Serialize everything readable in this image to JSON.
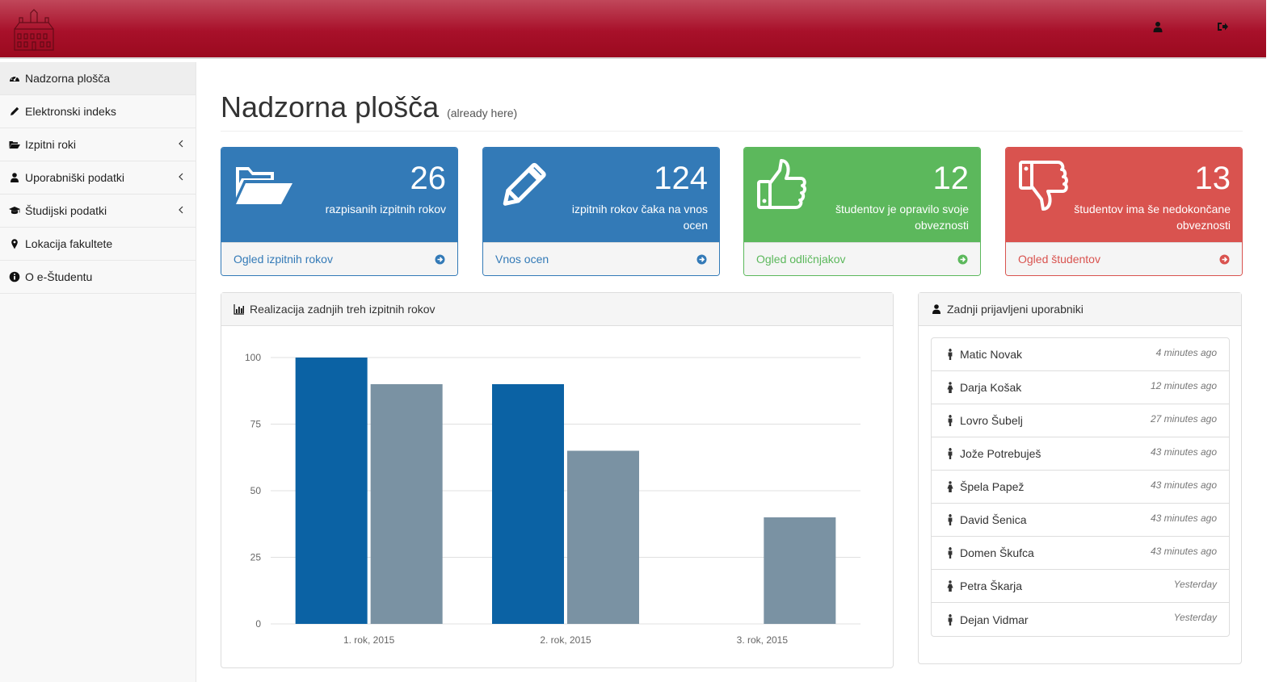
{
  "topbar": {
    "profile_icon": "user-icon",
    "logout_icon": "sign-out-icon"
  },
  "sidebar": {
    "items": [
      {
        "label": "Nadzorna plošča",
        "icon": "dashboard-icon",
        "active": true,
        "has_submenu": false
      },
      {
        "label": "Elektronski indeks",
        "icon": "pencil-icon",
        "active": false,
        "has_submenu": false
      },
      {
        "label": "Izpitni roki",
        "icon": "folder-open-icon",
        "active": false,
        "has_submenu": true
      },
      {
        "label": "Uporabniški podatki",
        "icon": "user-icon",
        "active": false,
        "has_submenu": true
      },
      {
        "label": "Študijski podatki",
        "icon": "graduation-cap-icon",
        "active": false,
        "has_submenu": true
      },
      {
        "label": "Lokacija fakultete",
        "icon": "map-marker-icon",
        "active": false,
        "has_submenu": false
      },
      {
        "label": "O e-Študentu",
        "icon": "info-circle-icon",
        "active": false,
        "has_submenu": false
      }
    ]
  },
  "header": {
    "title": "Nadzorna plošča",
    "subtitle": "(already here)"
  },
  "stats": [
    {
      "value": "26",
      "label": "razpisanih izpitnih rokov",
      "link": "Ogled izpitnih rokov",
      "icon": "folder-open-icon",
      "color": "#337ab7"
    },
    {
      "value": "124",
      "label": "izpitnih rokov čaka na vnos ocen",
      "link": "Vnos ocen",
      "icon": "pencil-icon",
      "color": "#337ab7"
    },
    {
      "value": "12",
      "label": "študentov je opravilo svoje obveznosti",
      "link": "Ogled odličnjakov",
      "icon": "thumbs-up-icon",
      "color": "#5cb85c"
    },
    {
      "value": "13",
      "label": "študentov ima še nedokončane obveznosti",
      "link": "Ogled študentov",
      "icon": "thumbs-down-icon",
      "color": "#d9534f"
    }
  ],
  "chart_panel": {
    "title": "Realizacija zadnjih treh izpitnih rokov",
    "icon": "bar-chart-icon"
  },
  "chart_data": {
    "type": "bar",
    "categories": [
      "1. rok, 2015",
      "2. rok, 2015",
      "3. rok, 2015"
    ],
    "series": [
      {
        "values": [
          100,
          90,
          0
        ],
        "color": "#0b62a4"
      },
      {
        "values": [
          90,
          65,
          40
        ],
        "color": "#7a92a3"
      }
    ],
    "title": "",
    "xlabel": "",
    "ylabel": "",
    "ylim": [
      0,
      100
    ],
    "yticks": [
      "0",
      "25",
      "50",
      "75",
      "100"
    ],
    "grid": true,
    "legend": "none"
  },
  "users_panel": {
    "title": "Zadnji prijavljeni uporabniki",
    "icon": "user-icon",
    "users": [
      {
        "name": "Matic Novak",
        "time": "4 minutes ago",
        "icon": "male-icon"
      },
      {
        "name": "Darja Košak",
        "time": "12 minutes ago",
        "icon": "female-icon"
      },
      {
        "name": "Lovro Šubelj",
        "time": "27 minutes ago",
        "icon": "male-icon"
      },
      {
        "name": "Jože Potrebuješ",
        "time": "43 minutes ago",
        "icon": "male-icon"
      },
      {
        "name": "Špela Papež",
        "time": "43 minutes ago",
        "icon": "female-icon"
      },
      {
        "name": "David Šenica",
        "time": "43 minutes ago",
        "icon": "male-icon"
      },
      {
        "name": "Domen Škufca",
        "time": "43 minutes ago",
        "icon": "male-icon"
      },
      {
        "name": "Petra Škarja",
        "time": "Yesterday",
        "icon": "female-icon"
      },
      {
        "name": "Dejan Vidmar",
        "time": "Yesterday",
        "icon": "male-icon"
      }
    ]
  }
}
